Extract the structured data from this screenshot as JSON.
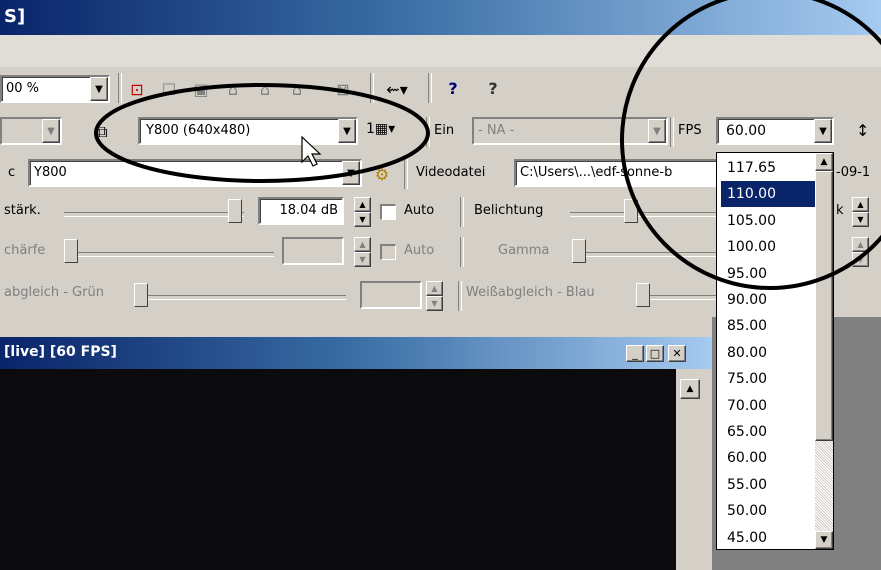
{
  "window": {
    "title_fragment": "S]"
  },
  "toolbar1": {
    "zoom_value": "00 %",
    "help_icon": "?",
    "help_arrow": "?"
  },
  "toolbar2": {
    "format_value": "Y800 (640x480)",
    "frames_label": "1",
    "ein_label": "Ein",
    "na_value": "- NA -",
    "fps_label": "FPS",
    "fps_value": "60.00",
    "arrow_glyph": "↕"
  },
  "row3": {
    "codec_prefix": "c",
    "codec_value": "Y800",
    "videodatei_label": "Videodatei",
    "videodatei_value": "C:\\Users\\...\\edf-sonne-b",
    "date_fragment": "-09-1"
  },
  "row4": {
    "gain_label": "stärk.",
    "gain_value": "18.04 dB",
    "auto_label": "Auto",
    "exposure_label": "Belichtung",
    "right_fragment": "k"
  },
  "row5": {
    "sharpness_label": "chärfe",
    "auto_label": "Auto",
    "gamma_label": "Gamma"
  },
  "row6": {
    "wb_green_label": "abgleich - Grün",
    "wb_blue_label": "Weißabgleich - Blau"
  },
  "subwindow": {
    "title": "[live] [60 FPS]"
  },
  "fps_dropdown": {
    "options": [
      "117.65",
      "110.00",
      "105.00",
      "100.00",
      "95.00",
      "90.00",
      "85.00",
      "80.00",
      "75.00",
      "70.00",
      "65.00",
      "60.00",
      "55.00",
      "50.00",
      "45.00"
    ],
    "selected": "110.00"
  },
  "colors": {
    "selection": "#0a246a",
    "face": "#d4d0c8",
    "video": "#0b0b0d"
  }
}
